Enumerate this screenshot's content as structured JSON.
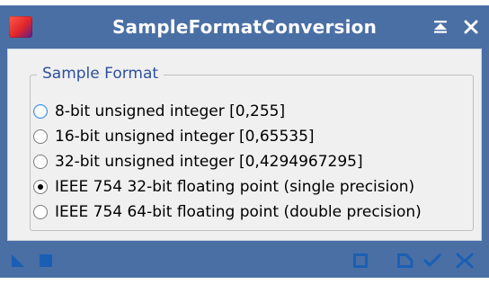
{
  "window": {
    "title": "SampleFormatConversion",
    "icons": {
      "app": "process-app-icon",
      "pin": "shade-collapse-icon",
      "close": "close-icon"
    }
  },
  "group": {
    "title": "Sample Format",
    "options": [
      {
        "label": "8-bit unsigned integer [0,255]",
        "selected": false
      },
      {
        "label": "16-bit unsigned integer [0,65535]",
        "selected": false
      },
      {
        "label": "32-bit unsigned integer [0,4294967295]",
        "selected": false
      },
      {
        "label": "IEEE 754 32-bit floating point (single precision)",
        "selected": true
      },
      {
        "label": "IEEE 754 64-bit floating point (double precision)",
        "selected": false
      }
    ]
  },
  "toolbar": {
    "left_icons": [
      "new-instance-triangle-icon",
      "apply-global-square-icon"
    ],
    "right_icons": [
      "preview-square-icon",
      "reset-icon",
      "ok-check-icon",
      "tools-icon"
    ]
  },
  "colors": {
    "frame": "#4a6fa5",
    "client": "#f0f0f0",
    "group_title": "#2c4f9e",
    "toolbar_icon": "#1a5fb4"
  }
}
